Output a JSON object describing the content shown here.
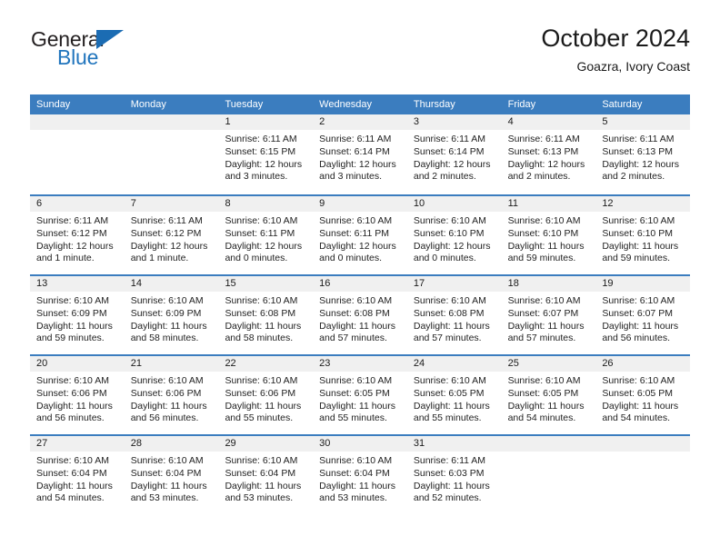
{
  "brand": {
    "name_top": "General",
    "name_bottom": "Blue",
    "accent_color": "#2175bd"
  },
  "header": {
    "title": "October 2024",
    "subtitle": "Goazra, Ivory Coast"
  },
  "theme": {
    "header_row_bg": "#3b7dbf",
    "day_band_bg": "#f0f0f0",
    "text_color": "#222222"
  },
  "weekdays": [
    "Sunday",
    "Monday",
    "Tuesday",
    "Wednesday",
    "Thursday",
    "Friday",
    "Saturday"
  ],
  "labels": {
    "sunrise_prefix": "Sunrise: ",
    "sunset_prefix": "Sunset: ",
    "daylight_prefix": "Daylight: "
  },
  "weeks": [
    [
      {
        "day": "",
        "empty": true
      },
      {
        "day": "",
        "empty": true
      },
      {
        "day": "1",
        "sunrise": "Sunrise: 6:11 AM",
        "sunset": "Sunset: 6:15 PM",
        "daylight": "Daylight: 12 hours and 3 minutes."
      },
      {
        "day": "2",
        "sunrise": "Sunrise: 6:11 AM",
        "sunset": "Sunset: 6:14 PM",
        "daylight": "Daylight: 12 hours and 3 minutes."
      },
      {
        "day": "3",
        "sunrise": "Sunrise: 6:11 AM",
        "sunset": "Sunset: 6:14 PM",
        "daylight": "Daylight: 12 hours and 2 minutes."
      },
      {
        "day": "4",
        "sunrise": "Sunrise: 6:11 AM",
        "sunset": "Sunset: 6:13 PM",
        "daylight": "Daylight: 12 hours and 2 minutes."
      },
      {
        "day": "5",
        "sunrise": "Sunrise: 6:11 AM",
        "sunset": "Sunset: 6:13 PM",
        "daylight": "Daylight: 12 hours and 2 minutes."
      }
    ],
    [
      {
        "day": "6",
        "sunrise": "Sunrise: 6:11 AM",
        "sunset": "Sunset: 6:12 PM",
        "daylight": "Daylight: 12 hours and 1 minute."
      },
      {
        "day": "7",
        "sunrise": "Sunrise: 6:11 AM",
        "sunset": "Sunset: 6:12 PM",
        "daylight": "Daylight: 12 hours and 1 minute."
      },
      {
        "day": "8",
        "sunrise": "Sunrise: 6:10 AM",
        "sunset": "Sunset: 6:11 PM",
        "daylight": "Daylight: 12 hours and 0 minutes."
      },
      {
        "day": "9",
        "sunrise": "Sunrise: 6:10 AM",
        "sunset": "Sunset: 6:11 PM",
        "daylight": "Daylight: 12 hours and 0 minutes."
      },
      {
        "day": "10",
        "sunrise": "Sunrise: 6:10 AM",
        "sunset": "Sunset: 6:10 PM",
        "daylight": "Daylight: 12 hours and 0 minutes."
      },
      {
        "day": "11",
        "sunrise": "Sunrise: 6:10 AM",
        "sunset": "Sunset: 6:10 PM",
        "daylight": "Daylight: 11 hours and 59 minutes."
      },
      {
        "day": "12",
        "sunrise": "Sunrise: 6:10 AM",
        "sunset": "Sunset: 6:10 PM",
        "daylight": "Daylight: 11 hours and 59 minutes."
      }
    ],
    [
      {
        "day": "13",
        "sunrise": "Sunrise: 6:10 AM",
        "sunset": "Sunset: 6:09 PM",
        "daylight": "Daylight: 11 hours and 59 minutes."
      },
      {
        "day": "14",
        "sunrise": "Sunrise: 6:10 AM",
        "sunset": "Sunset: 6:09 PM",
        "daylight": "Daylight: 11 hours and 58 minutes."
      },
      {
        "day": "15",
        "sunrise": "Sunrise: 6:10 AM",
        "sunset": "Sunset: 6:08 PM",
        "daylight": "Daylight: 11 hours and 58 minutes."
      },
      {
        "day": "16",
        "sunrise": "Sunrise: 6:10 AM",
        "sunset": "Sunset: 6:08 PM",
        "daylight": "Daylight: 11 hours and 57 minutes."
      },
      {
        "day": "17",
        "sunrise": "Sunrise: 6:10 AM",
        "sunset": "Sunset: 6:08 PM",
        "daylight": "Daylight: 11 hours and 57 minutes."
      },
      {
        "day": "18",
        "sunrise": "Sunrise: 6:10 AM",
        "sunset": "Sunset: 6:07 PM",
        "daylight": "Daylight: 11 hours and 57 minutes."
      },
      {
        "day": "19",
        "sunrise": "Sunrise: 6:10 AM",
        "sunset": "Sunset: 6:07 PM",
        "daylight": "Daylight: 11 hours and 56 minutes."
      }
    ],
    [
      {
        "day": "20",
        "sunrise": "Sunrise: 6:10 AM",
        "sunset": "Sunset: 6:06 PM",
        "daylight": "Daylight: 11 hours and 56 minutes."
      },
      {
        "day": "21",
        "sunrise": "Sunrise: 6:10 AM",
        "sunset": "Sunset: 6:06 PM",
        "daylight": "Daylight: 11 hours and 56 minutes."
      },
      {
        "day": "22",
        "sunrise": "Sunrise: 6:10 AM",
        "sunset": "Sunset: 6:06 PM",
        "daylight": "Daylight: 11 hours and 55 minutes."
      },
      {
        "day": "23",
        "sunrise": "Sunrise: 6:10 AM",
        "sunset": "Sunset: 6:05 PM",
        "daylight": "Daylight: 11 hours and 55 minutes."
      },
      {
        "day": "24",
        "sunrise": "Sunrise: 6:10 AM",
        "sunset": "Sunset: 6:05 PM",
        "daylight": "Daylight: 11 hours and 55 minutes."
      },
      {
        "day": "25",
        "sunrise": "Sunrise: 6:10 AM",
        "sunset": "Sunset: 6:05 PM",
        "daylight": "Daylight: 11 hours and 54 minutes."
      },
      {
        "day": "26",
        "sunrise": "Sunrise: 6:10 AM",
        "sunset": "Sunset: 6:05 PM",
        "daylight": "Daylight: 11 hours and 54 minutes."
      }
    ],
    [
      {
        "day": "27",
        "sunrise": "Sunrise: 6:10 AM",
        "sunset": "Sunset: 6:04 PM",
        "daylight": "Daylight: 11 hours and 54 minutes."
      },
      {
        "day": "28",
        "sunrise": "Sunrise: 6:10 AM",
        "sunset": "Sunset: 6:04 PM",
        "daylight": "Daylight: 11 hours and 53 minutes."
      },
      {
        "day": "29",
        "sunrise": "Sunrise: 6:10 AM",
        "sunset": "Sunset: 6:04 PM",
        "daylight": "Daylight: 11 hours and 53 minutes."
      },
      {
        "day": "30",
        "sunrise": "Sunrise: 6:10 AM",
        "sunset": "Sunset: 6:04 PM",
        "daylight": "Daylight: 11 hours and 53 minutes."
      },
      {
        "day": "31",
        "sunrise": "Sunrise: 6:11 AM",
        "sunset": "Sunset: 6:03 PM",
        "daylight": "Daylight: 11 hours and 52 minutes."
      },
      {
        "day": "",
        "empty": true
      },
      {
        "day": "",
        "empty": true
      }
    ]
  ]
}
